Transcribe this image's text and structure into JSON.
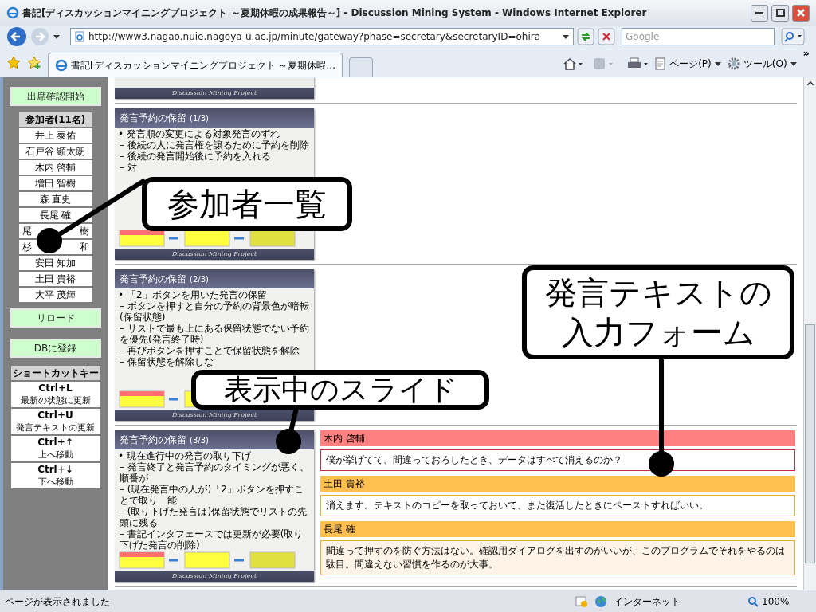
{
  "window": {
    "title": "書記[ディスカッションマイニングプロジェクト ～夏期休暇の成果報告～] - Discussion Mining System - Windows Internet Explorer"
  },
  "address_bar": {
    "url": "http://www3.nagao.nuie.nagoya-u.ac.jp/minute/gateway?phase=secretary&secretaryID=ohira",
    "search_placeholder": "Google"
  },
  "tabs": [
    {
      "label": "書記[ディスカッションマイニングプロジェクト ～夏期休暇...",
      "selected": true
    }
  ],
  "command_bar": {
    "page_menu": "ページ(P)",
    "tools_menu": "ツール(O)",
    "more": "»"
  },
  "sidebar": {
    "attendance_button": "出席確認開始",
    "participants_header": "参加者(11名)",
    "participants": [
      {
        "parts": [
          "井上 泰佑"
        ]
      },
      {
        "parts": [
          "石戸谷 顕太朗"
        ]
      },
      {
        "parts": [
          "木内 啓輔"
        ]
      },
      {
        "parts": [
          "増田 智樹"
        ]
      },
      {
        "parts": [
          "森 直史"
        ]
      },
      {
        "parts": [
          "長尾 確"
        ]
      },
      {
        "parts": [
          "尾",
          "樹"
        ]
      },
      {
        "parts": [
          "杉",
          "和"
        ]
      },
      {
        "parts": [
          "安田 知加"
        ]
      },
      {
        "parts": [
          "土田 貴裕"
        ]
      },
      {
        "parts": [
          "大平 茂輝"
        ]
      }
    ],
    "reload_button": "リロード",
    "register_button": "DBに登録",
    "shortcuts_header": "ショートカットキー",
    "shortcuts": [
      {
        "key": "Ctrl+L",
        "action": "最新の状態に更新"
      },
      {
        "key": "Ctrl+U",
        "action": "発言テキストの更新"
      },
      {
        "key": "Ctrl+↑",
        "action": "上へ移動"
      },
      {
        "key": "Ctrl+↓",
        "action": "下へ移動"
      }
    ]
  },
  "slides": [
    {
      "kind": "footer-only",
      "footer": "Discussion Mining Project"
    },
    {
      "kind": "full",
      "title": "発言予約の保留",
      "page": "(1/3)",
      "bullet": "• 発言順の変更による対象発言のずれ",
      "subs": [
        "– 後続の人に発言権を譲るために予約を削除",
        "– 後続の発言開始後に予約を入れる",
        "– 対"
      ],
      "footer": "Discussion Mining Project"
    },
    {
      "kind": "full",
      "title": "発言予約の保留",
      "page": "(2/3)",
      "bullet": "• 「2」ボタンを用いた発言の保留",
      "subs": [
        "– ボタンを押すと自分の予約の背景色が暗転(保留状態)",
        "– リストで最も上にある保留状態でない予約を優先(発言終了時)",
        "– 再びボタンを押すことで保留状態を解除",
        "– 保留状態を解除しな"
      ],
      "footer": "Discussion Mining Project"
    },
    {
      "kind": "full",
      "title": "発言予約の保留",
      "page": "(3/3)",
      "bullet": "• 現在進行中の発言の取り下げ",
      "subs": [
        "– 発言終了と発言予約のタイミングが悪く、順番が",
        "– (現在発言中の人が)「2」ボタンを押すことで取り　能",
        "– (取り下げた発言は)保留状態でリストの先頭に残る",
        "– 書記インタフェースでは更新が必要(取り下げた発言の削除)"
      ],
      "footer": "Discussion Mining Project"
    }
  ],
  "comments": [
    {
      "speaker": "木内 啓輔",
      "color": "#ff8080",
      "text": "僕が挙げてて、間違っておろしたとき、データはすべて消えるのか？",
      "highlighted": false
    },
    {
      "speaker": "土田 貴裕",
      "color": "#ffc050",
      "text": "消えます。テキストのコピーを取っておいて、また復活したときにペーストすればいい。",
      "highlighted": false
    },
    {
      "speaker": "長尾 確",
      "color": "#ffc050",
      "text": "間違って押すのを防ぐ方法はない。確認用ダイアログを出すのがいいが、このプログラムでそれをやるのは駄目。間違えない習慣を作るのが大事。",
      "highlighted": true
    }
  ],
  "callouts": [
    "参加者一覧",
    "表示中のスライド",
    "発言テキストの入力フォーム"
  ],
  "status_bar": {
    "text": "ページが表示されました",
    "zone": "インターネット",
    "zoom": "100%"
  }
}
